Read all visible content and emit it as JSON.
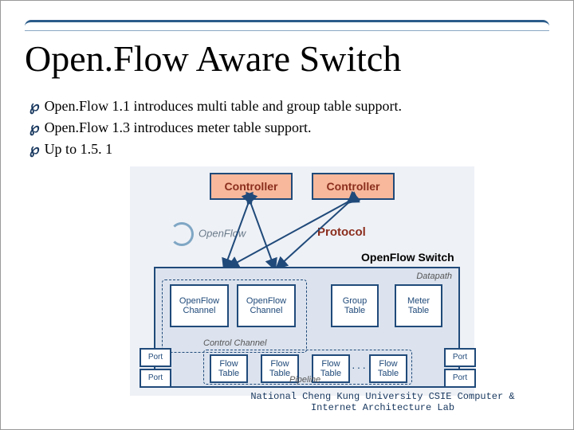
{
  "title": "Open.Flow Aware Switch",
  "bullets": [
    "Open.Flow 1.1 introduces multi table and group table support.",
    "Open.Flow 1.3 introduces meter table support.",
    "Up to 1.5. 1"
  ],
  "diagram": {
    "controller": "Controller",
    "openflow_brand": "OpenFlow",
    "protocol": "Protocol",
    "switch_label": "OpenFlow Switch",
    "datapath": "Datapath",
    "of_channel": "OpenFlow\nChannel",
    "group_table": "Group\nTable",
    "meter_table": "Meter\nTable",
    "control_channel": "Control Channel",
    "flow_table": "Flow\nTable",
    "port": "Port",
    "pipeline": "Pipeline"
  },
  "footer_line1": "National Cheng Kung University CSIE Computer &",
  "footer_line2": "Internet Architecture Lab"
}
